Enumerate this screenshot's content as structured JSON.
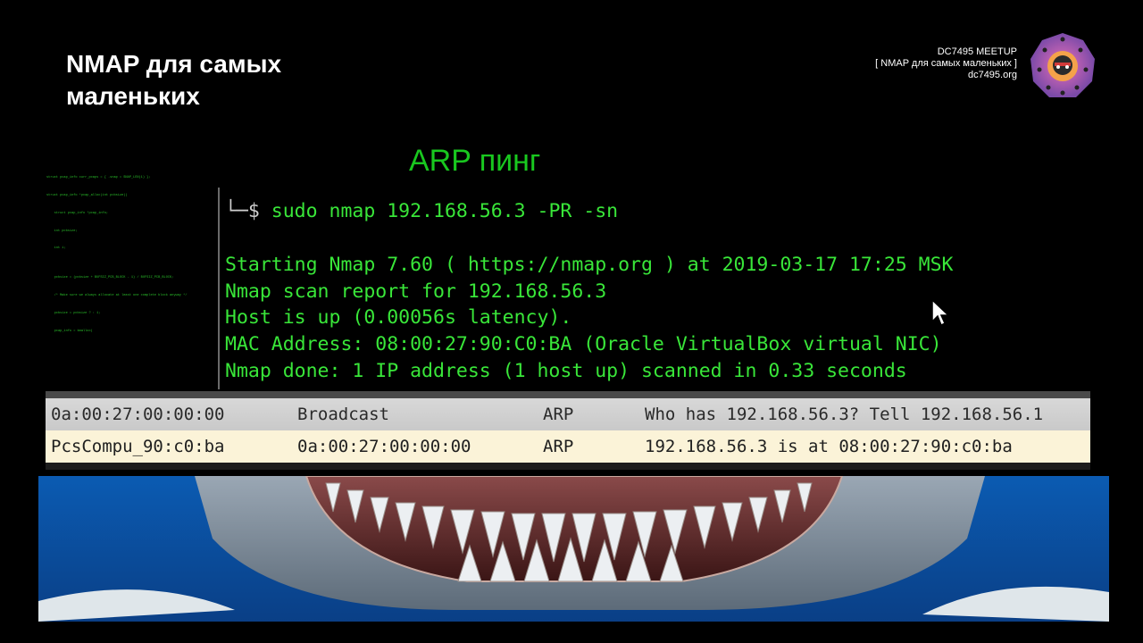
{
  "slide": {
    "title": "NMAP для самых маленьких",
    "meetup_name": "DC7495 MEETUP",
    "meetup_topic": "[ NMAP для самых маленьких ]",
    "meetup_site": "dc7495.org",
    "heading": "ARP пинг"
  },
  "code_thumbnail": {
    "lines": [
      "struct pcap_info curr_pcaps = { .snap = SNAP_LEN(1) };",
      "struct pcap_info *pcap_alloc(int pcbsize))",
      "    struct pcap_info *pcap_info;",
      "    int pcbsize;",
      "    int i;",
      "",
      "    pcbsize = (pcbsize + BUFSIZ_PCB_BLOCK - 1) / BUFSIZ_PCB_BLOCK;",
      "    /* Make sure we always allocate at least one complete block anyway */",
      "    pcbsize = pcbsize ? : 1;",
      "    pcap_info = kmalloc("
    ]
  },
  "terminal": {
    "prompt_glyph": "└─$",
    "command": " sudo nmap 192.168.56.3 -PR -sn",
    "output": [
      "Starting Nmap 7.60 ( https://nmap.org ) at 2019-03-17 17:25 MSK",
      "Nmap scan report for 192.168.56.3",
      "Host is up (0.00056s latency).",
      "MAC Address: 08:00:27:90:C0:BA (Oracle VirtualBox virtual NIC)",
      "Nmap done: 1 IP address (1 host up) scanned in 0.33 seconds"
    ]
  },
  "packet_list": {
    "rows": [
      {
        "source": "0a:00:27:00:00:00",
        "destination": "Broadcast",
        "protocol": "ARP",
        "info": "Who has 192.168.56.3? Tell 192.168.56.1"
      },
      {
        "source": "PcsCompu_90:c0:ba",
        "destination": "0a:00:27:00:00:00",
        "protocol": "ARP",
        "info": "192.168.56.3 is at 08:00:27:90:c0:ba"
      }
    ]
  },
  "colors": {
    "terminal_green": "#39e639",
    "heading_green": "#19c81f",
    "selected_row": "#fbf3d8"
  }
}
